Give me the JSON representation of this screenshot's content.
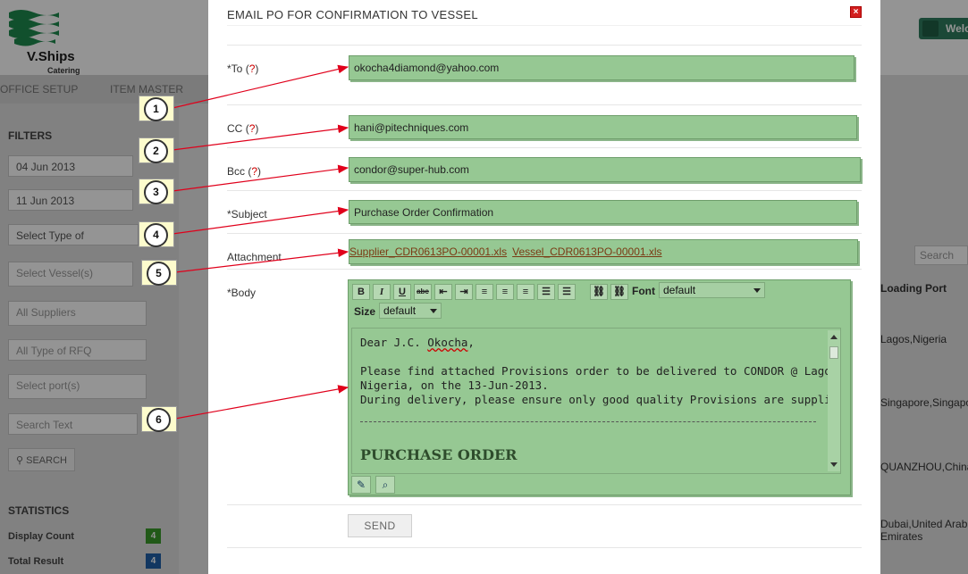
{
  "background": {
    "logo": {
      "name": "V.Ships",
      "sub": "Catering"
    },
    "welcome_text": "Welc",
    "nav": [
      "OFFICE SETUP",
      "ITEM MASTER"
    ],
    "filters": {
      "title": "FILTERS",
      "date_from": "04 Jun 2013",
      "date_to": "11 Jun 2013",
      "type_placeholder": "Select Type of",
      "vessel_placeholder": "Select Vessel(s)",
      "suppliers_placeholder": "All Suppliers",
      "rfq_placeholder": "All Type of RFQ",
      "port_placeholder": "Select port(s)",
      "search_text_placeholder": "Search Text",
      "search_button": "SEARCH"
    },
    "statistics": {
      "title": "STATISTICS",
      "rows": [
        {
          "label": "Display Count",
          "value": "4",
          "color": "#3a9a2a"
        },
        {
          "label": "Total Result",
          "value": "4",
          "color": "#1f5fa8"
        }
      ]
    },
    "grid": {
      "search_placeholder": "Search",
      "column_title": "Loading Port",
      "rows": [
        "Lagos,Nigeria",
        "Singapore,Singapo",
        "QUANZHOU,China",
        "Dubai,United Arab",
        "Emirates"
      ]
    }
  },
  "modal": {
    "title": "EMAIL PO FOR CONFIRMATION TO VESSEL",
    "close_symbol": "×",
    "fields": {
      "to": {
        "label": "*To",
        "help": "?",
        "value": "okocha4diamond@yahoo.com"
      },
      "cc": {
        "label": "CC",
        "help": "?",
        "value": "hani@pitechniques.com"
      },
      "bcc": {
        "label": "Bcc",
        "help": "?",
        "value": "condor@super-hub.com"
      },
      "subject": {
        "label": "*Subject",
        "value": "Purchase Order Confirmation"
      },
      "attachment": {
        "label": "Attachment",
        "files": [
          "Supplier_CDR0613PO-00001.xls",
          "Vessel_CDR0613PO-00001.xls"
        ]
      },
      "body": {
        "label": "*Body"
      }
    },
    "editor": {
      "toolbar": {
        "buttons": [
          {
            "name": "bold-button",
            "glyph": "B"
          },
          {
            "name": "italic-button",
            "glyph": "I"
          },
          {
            "name": "underline-button",
            "glyph": "U"
          },
          {
            "name": "strikethrough-button",
            "glyph": "abc"
          },
          {
            "name": "outdent-button",
            "glyph": "⇤"
          },
          {
            "name": "indent-button",
            "glyph": "⇥"
          },
          {
            "name": "align-center-button",
            "glyph": "≡"
          },
          {
            "name": "align-left-button",
            "glyph": "≡"
          },
          {
            "name": "align-right-button",
            "glyph": "≡"
          },
          {
            "name": "ordered-list-button",
            "glyph": "☰"
          },
          {
            "name": "unordered-list-button",
            "glyph": "☰"
          },
          {
            "name": "link-button",
            "glyph": "⛓"
          },
          {
            "name": "unlink-button",
            "glyph": "⛓"
          }
        ],
        "font_label": "Font",
        "font_value": "default",
        "size_label": "Size",
        "size_value": "default"
      },
      "body_lines": [
        "Dear J.C. Okocha,",
        "Please find attached Provisions order to be delivered to CONDOR @ Lagos,",
        "Nigeria, on the 13-Jun-2013.",
        "During delivery, please ensure only good quality Provisions are supplied."
      ],
      "heading": "PURCHASE ORDER",
      "bottom_buttons": [
        {
          "name": "design-mode-icon",
          "glyph": "✎"
        },
        {
          "name": "preview-mode-icon",
          "glyph": "⌕"
        }
      ]
    },
    "send_button": "SEND"
  },
  "callouts": [
    "1",
    "2",
    "3",
    "4",
    "5",
    "6"
  ],
  "annotation_color": "#e0001b"
}
